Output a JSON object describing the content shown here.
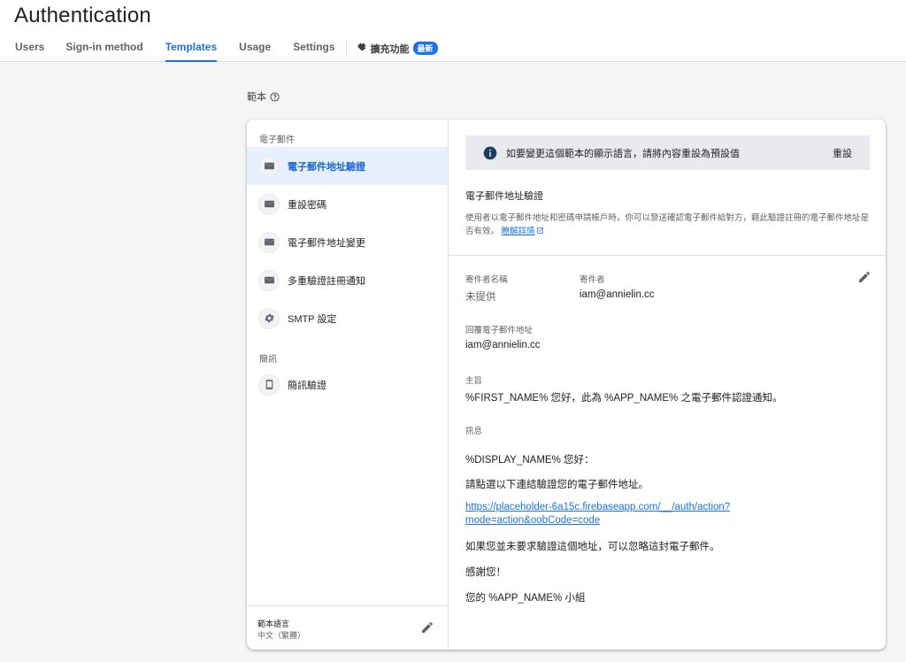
{
  "header": {
    "title": "Authentication",
    "tabs": [
      {
        "label": "Users"
      },
      {
        "label": "Sign-in method"
      },
      {
        "label": "Templates"
      },
      {
        "label": "Usage"
      },
      {
        "label": "Settings"
      }
    ],
    "extensions": {
      "label": "擴充功能",
      "badge": "最新"
    }
  },
  "section": {
    "label": "範本"
  },
  "sidebar": {
    "email_group": "電子郵件",
    "sms_group": "簡訊",
    "items": [
      {
        "label": "電子郵件地址驗證",
        "icon": "mail-icon"
      },
      {
        "label": "重設密碼",
        "icon": "mail-icon"
      },
      {
        "label": "電子郵件地址變更",
        "icon": "mail-icon"
      },
      {
        "label": "多重驗證註冊通知",
        "icon": "mail-icon"
      },
      {
        "label": "SMTP 設定",
        "icon": "gear-icon"
      },
      {
        "label": "簡訊驗證",
        "icon": "phone-icon"
      }
    ],
    "language": {
      "title": "範本語言",
      "value": "中文（繁體）"
    }
  },
  "main": {
    "banner": {
      "text": "如要變更這個範本的顯示語言，請將內容重設為預設值",
      "reset": "重設"
    },
    "template_title": "電子郵件地址驗證",
    "template_desc": "使用者以電子郵件地址和密碼申請帳戶時，你可以發送確認電子郵件給對方，藉此驗證註冊的電子郵件地址是否有效。",
    "learn_more": "瞭解詳情",
    "sender_name": {
      "label": "寄件者名稱",
      "value": "未提供"
    },
    "sender": {
      "label": "寄件者",
      "value": "iam@annielin.cc"
    },
    "reply_to": {
      "label": "回覆電子郵件地址",
      "value": "iam@annielin.cc"
    },
    "subject": {
      "label": "主旨",
      "value": "%FIRST_NAME% 您好，此為 %APP_NAME% 之電子郵件認證通知。"
    },
    "message": {
      "label": "訊息",
      "greeting": "%DISPLAY_NAME% 您好：",
      "instruction": "請點選以下連結驗證您的電子郵件地址。",
      "link": "https://placeholder-6a15c.firebaseapp.com/__/auth/action?mode=action&oobCode=code",
      "ignore": "如果您並未要求驗證這個地址，可以忽略這封電子郵件。",
      "thanks": "感謝您！",
      "signature": "您的 %APP_NAME% 小組"
    }
  },
  "colors": {
    "accent": "#1a73e8",
    "active_bg": "#e8f0fe",
    "banner_bg": "#e8eaed"
  }
}
